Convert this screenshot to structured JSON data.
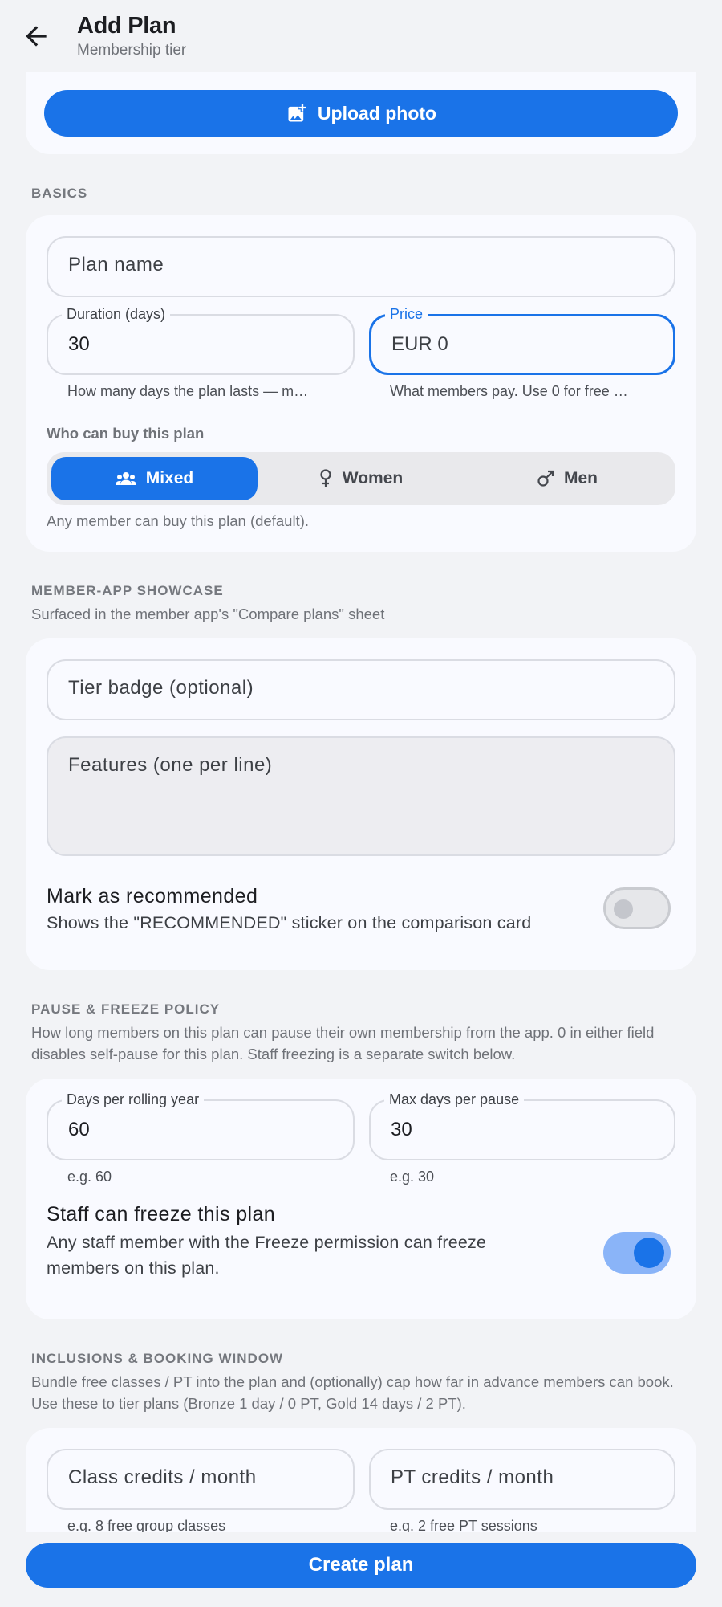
{
  "header": {
    "title": "Add Plan",
    "subtitle": "Membership tier"
  },
  "photo": {
    "upload_label": "Upload photo"
  },
  "basics": {
    "section_title": "BASICS",
    "plan_name_placeholder": "Plan name",
    "duration": {
      "label": "Duration (days)",
      "value": "30",
      "helper": "How many days the plan lasts — m…"
    },
    "price": {
      "label": "Price",
      "value": "EUR 0",
      "helper": "What members pay. Use 0 for free …"
    },
    "audience": {
      "label": "Who can buy this plan",
      "options": [
        "Mixed",
        "Women",
        "Men"
      ],
      "selected": "Mixed",
      "note": "Any member can buy this plan (default)."
    }
  },
  "showcase": {
    "section_title": "MEMBER-APP SHOWCASE",
    "description": "Surfaced in the member app's \"Compare plans\" sheet",
    "tier_badge_placeholder": "Tier badge (optional)",
    "features_placeholder": "Features (one per line)",
    "recommended": {
      "title": "Mark as recommended",
      "subtitle": "Shows the \"RECOMMENDED\" sticker on the comparison card",
      "enabled": false
    }
  },
  "pause": {
    "section_title": "PAUSE & FREEZE POLICY",
    "description": "How long members on this plan can pause their own membership from the app. 0 in either field disables self-pause for this plan. Staff freezing is a separate switch below.",
    "days_per_year": {
      "label": "Days per rolling year",
      "value": "60",
      "helper": "e.g. 60"
    },
    "max_per_pause": {
      "label": "Max days per pause",
      "value": "30",
      "helper": "e.g. 30"
    },
    "staff_freeze": {
      "title": "Staff can freeze this plan",
      "subtitle": "Any staff member with the Freeze permission can freeze members on this plan.",
      "enabled": true
    }
  },
  "inclusions": {
    "section_title": "INCLUSIONS & BOOKING WINDOW",
    "description": "Bundle free classes / PT into the plan and (optionally) cap how far in advance members can book. Use these to tier plans (Bronze 1 day / 0 PT, Gold 14 days / 2 PT).",
    "class_credits": {
      "placeholder": "Class credits / month",
      "helper": "e.g. 8 free group classes"
    },
    "pt_credits": {
      "placeholder": "PT credits / month",
      "helper": "e.g. 2 free PT sessions"
    }
  },
  "footer": {
    "create_label": "Create plan"
  },
  "colors": {
    "accent": "#1a73e8",
    "background": "#f2f3f6",
    "card": "#f9faff"
  }
}
